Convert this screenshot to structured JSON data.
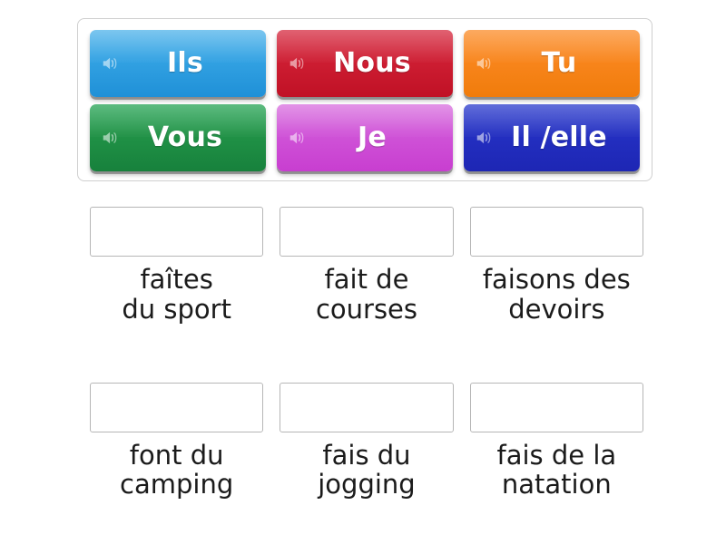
{
  "activity": {
    "type": "drag-and-drop-matching",
    "language": "fr"
  },
  "tray": {
    "tiles": [
      {
        "label": "Ils",
        "color": "#1f90d7",
        "variant": "c-blue",
        "icon": "speaker-icon"
      },
      {
        "label": "Nous",
        "color": "#c01125",
        "variant": "c-red",
        "icon": "speaker-icon"
      },
      {
        "label": "Tu",
        "color": "#f07c0b",
        "variant": "c-orange",
        "icon": "speaker-icon"
      },
      {
        "label": "Vous",
        "color": "#17813c",
        "variant": "c-green",
        "icon": "speaker-icon"
      },
      {
        "label": "Je",
        "color": "#c83ed0",
        "variant": "c-purple",
        "icon": "speaker-icon"
      },
      {
        "label": "Il /elle",
        "color": "#1d26b4",
        "variant": "c-navy",
        "icon": "speaker-icon"
      }
    ]
  },
  "answers": {
    "items": [
      {
        "text": "faîtes\ndu sport",
        "dropped": ""
      },
      {
        "text": "fait de\ncourses",
        "dropped": ""
      },
      {
        "text": "faisons des\ndevoirs",
        "dropped": ""
      },
      {
        "text": "font du\ncamping",
        "dropped": ""
      },
      {
        "text": "fais du\njogging",
        "dropped": ""
      },
      {
        "text": "fais de la\nnatation",
        "dropped": ""
      }
    ]
  },
  "colors": {
    "page_background": "#ffffff",
    "tray_border": "#cfcfcf",
    "drop_zone_border": "#b6b6b6",
    "text": "#1b1b1b",
    "tile_text": "#ffffff"
  }
}
